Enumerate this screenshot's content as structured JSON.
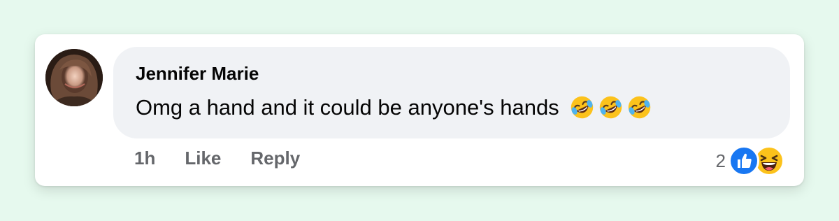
{
  "comment": {
    "author": "Jennifer Marie",
    "text": "Omg a hand and it could be anyone's hands",
    "trailing_emojis": [
      "rolling-on-floor-laughing",
      "rolling-on-floor-laughing",
      "rolling-on-floor-laughing"
    ],
    "timestamp": "1h",
    "like_label": "Like",
    "reply_label": "Reply",
    "reaction_count": "2",
    "reactions": [
      "like",
      "haha"
    ]
  },
  "colors": {
    "page_background": "#e6f9ee",
    "bubble_background": "#f0f2f5",
    "text_primary": "#050505",
    "text_secondary": "#65676b",
    "like_blue": "#1877f2",
    "emoji_yellow": "#fcc21b"
  }
}
